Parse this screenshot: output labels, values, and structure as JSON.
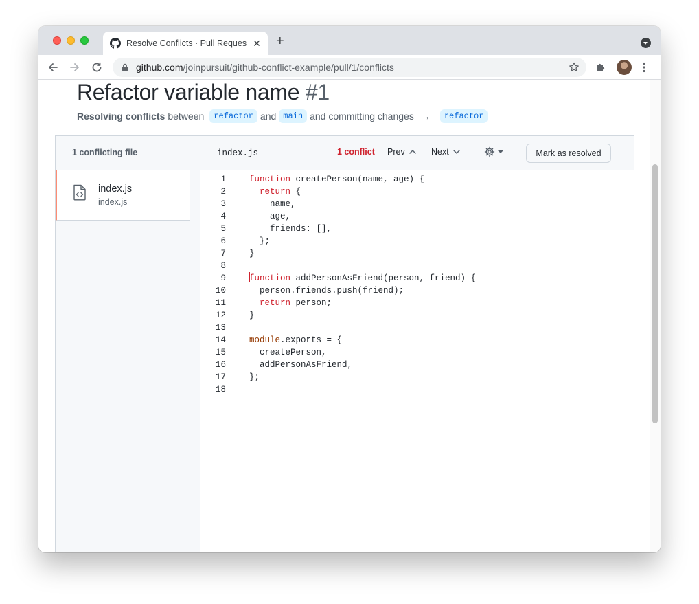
{
  "browser": {
    "tab_title": "Resolve Conflicts · Pull Reques",
    "tab_close": "✕",
    "new_tab": "+",
    "url_host": "github.com",
    "url_path": "/joinpursuit/github-conflict-example/pull/1/conflicts"
  },
  "pr": {
    "title": "Refactor variable name",
    "number": "#1",
    "resolving_label": "Resolving conflicts",
    "between": "between",
    "head_branch": "refactor",
    "and": "and",
    "base_branch": "main",
    "committing": "and committing changes",
    "arrow": "→",
    "target_branch": "refactor"
  },
  "resolver": {
    "files_header": "1 conflicting file",
    "current_file": "index.js",
    "conflict_count": "1 conflict",
    "prev_label": "Prev",
    "next_label": "Next",
    "mark_resolved_label": "Mark as resolved",
    "files": [
      {
        "name": "index.js",
        "path": "index.js"
      }
    ],
    "code": [
      {
        "n": "1",
        "text": "function createPerson(name, age) {"
      },
      {
        "n": "2",
        "text": "  return {"
      },
      {
        "n": "3",
        "text": "    name,"
      },
      {
        "n": "4",
        "text": "    age,"
      },
      {
        "n": "5",
        "text": "    friends: [],"
      },
      {
        "n": "6",
        "text": "  };"
      },
      {
        "n": "7",
        "text": "}"
      },
      {
        "n": "8",
        "text": ""
      },
      {
        "n": "9",
        "text": "function addPersonAsFriend(person, friend) {"
      },
      {
        "n": "10",
        "text": "  person.friends.push(friend);"
      },
      {
        "n": "11",
        "text": "  return person;"
      },
      {
        "n": "12",
        "text": "}"
      },
      {
        "n": "13",
        "text": ""
      },
      {
        "n": "14",
        "text": "module.exports = {"
      },
      {
        "n": "15",
        "text": "  createPerson,"
      },
      {
        "n": "16",
        "text": "  addPersonAsFriend,"
      },
      {
        "n": "17",
        "text": "};"
      },
      {
        "n": "18",
        "text": ""
      }
    ],
    "cursor_line": "9"
  },
  "colors": {
    "keyword": "#cf222e",
    "entity": "#953800",
    "conflict": "#cf222e",
    "branch_bg": "#ddf4ff",
    "branch_fg": "#0969da",
    "active_file_border": "#fd8c73"
  },
  "icons": {
    "github": "github-icon",
    "back": "arrow-left-icon",
    "forward": "arrow-right-icon",
    "reload": "reload-icon",
    "lock": "lock-icon",
    "star": "star-icon",
    "extensions": "puzzle-icon",
    "menu": "kebab-icon",
    "file": "file-code-icon",
    "gear": "gear-icon"
  }
}
